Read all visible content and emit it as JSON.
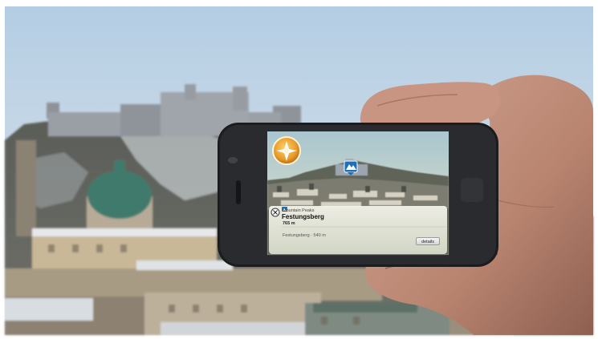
{
  "photo": {
    "sky_color": "#c9d8e6",
    "fortress_color": "#8a8f98",
    "hill_color": "#4b4f4a",
    "dome_color": "#3f7a6c"
  },
  "ar_app": {
    "compass_icon": "sun-compass-icon",
    "marker_icon": "poi-marker-icon",
    "poi_card": {
      "close_icon": "close-icon",
      "category_icon": "mountain-icon",
      "category": "Mountain Peaks",
      "title": "Festungsberg",
      "elevation": "765 m",
      "route": "Festungsberg · 540 m",
      "details_label": "details"
    }
  }
}
